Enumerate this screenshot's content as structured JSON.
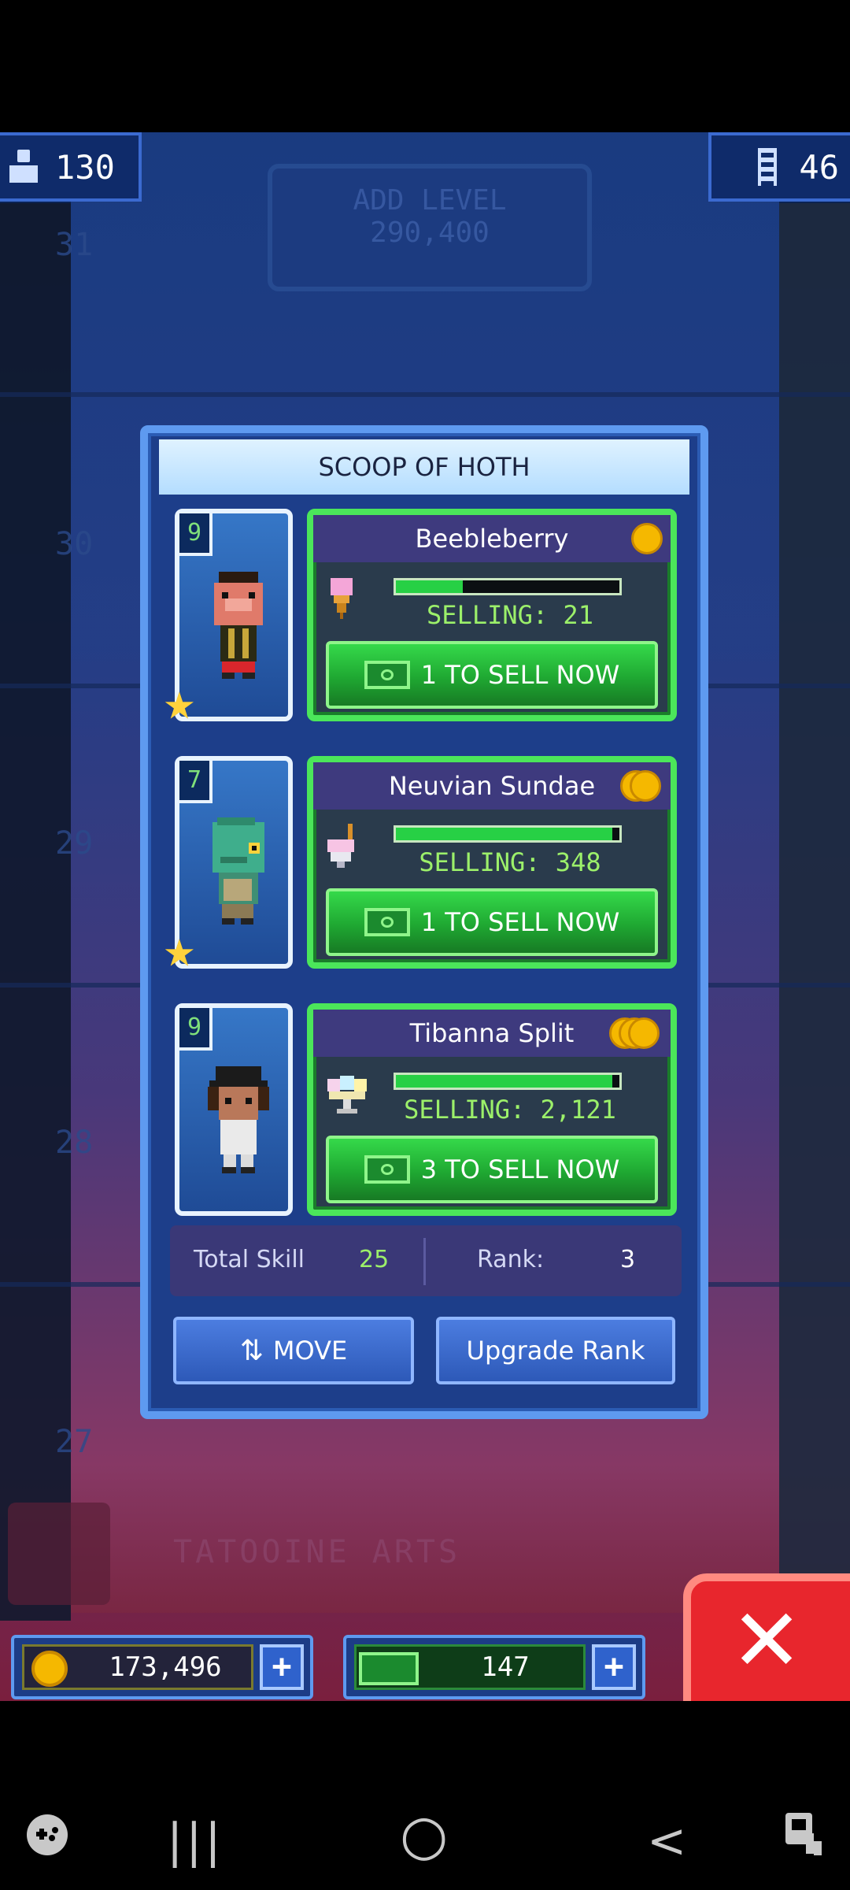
{
  "hud": {
    "population": "130",
    "floors": "46"
  },
  "background": {
    "add_level_label": "ADD LEVEL",
    "add_level_cost": "290,400",
    "floor_numbers": [
      "31",
      "30",
      "29",
      "28",
      "27"
    ],
    "floor_name": "TATOOINE ARTS"
  },
  "dialog": {
    "title": "SCOOP OF HOTH",
    "rows": [
      {
        "level": "9",
        "starred": true,
        "product": "Beebleberry",
        "coin_count": 1,
        "progress": 0.3,
        "selling": "SELLING: 21",
        "sell_label": "1 TO SELL NOW",
        "food_icon": "ice-cream-cone-icon"
      },
      {
        "level": "7",
        "starred": true,
        "product": "Neuvian Sundae",
        "coin_count": 2,
        "progress": 0.97,
        "selling": "SELLING: 348",
        "sell_label": "1 TO SELL NOW",
        "food_icon": "sundae-icon"
      },
      {
        "level": "9",
        "starred": false,
        "product": "Tibanna Split",
        "coin_count": 3,
        "progress": 0.97,
        "selling": "SELLING: 2,121",
        "sell_label": "3 TO SELL NOW",
        "food_icon": "banana-split-icon"
      }
    ],
    "total_skill_label": "Total Skill",
    "total_skill": "25",
    "rank_label": "Rank:",
    "rank": "3",
    "move_label": "MOVE",
    "upgrade_label": "Upgrade Rank"
  },
  "currency": {
    "coins": "173,496",
    "bux": "147"
  },
  "colors": {
    "accent_green": "#4be65a",
    "dialog_blue": "#1d3e8a",
    "close_red": "#e8262d"
  },
  "nav": {
    "game_icon": "game-launcher-icon",
    "recents": "|||",
    "home": "○",
    "back": "<",
    "assist": "accessibility-icon"
  }
}
